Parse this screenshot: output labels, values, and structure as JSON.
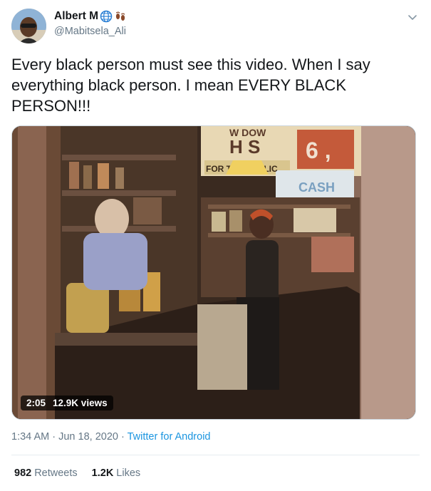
{
  "user": {
    "display_name": "Albert M",
    "handle": "@Mabitsela_Ali",
    "name_emojis": [
      "globe-emoji",
      "footprints-emoji"
    ]
  },
  "tweet": {
    "text": "Every black person must see this video. When I say everything black person. I mean EVERY BLACK PERSON!!!"
  },
  "media": {
    "duration": "2:05",
    "views": "12.9K views",
    "scene_signs": {
      "sign_top": "W   DOW",
      "sign_big": "H   S",
      "sign_banner": "FOR THE PUBLIC",
      "price": "6 ,",
      "cash_sign": "CASH"
    }
  },
  "meta": {
    "time": "1:34 AM",
    "separator": "·",
    "date": "Jun 18, 2020",
    "source": "Twitter for Android"
  },
  "stats": {
    "retweets_count": "982",
    "retweets_label": "Retweets",
    "likes_count": "1.2K",
    "likes_label": "Likes"
  },
  "colors": {
    "link": "#1b95e0",
    "secondary_text": "#657786",
    "primary_text": "#14171a"
  }
}
